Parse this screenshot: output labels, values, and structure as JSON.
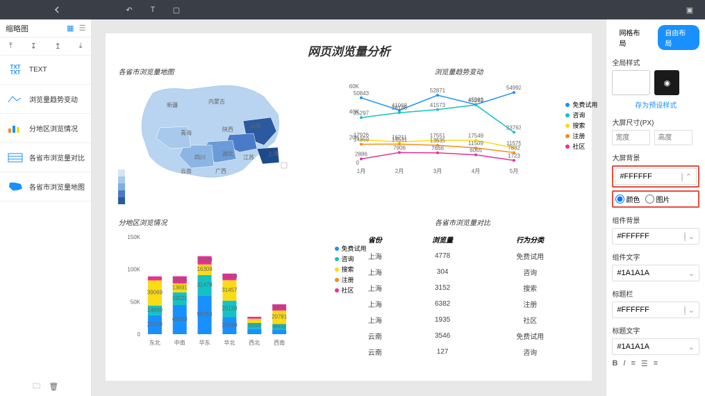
{
  "topbar": {
    "tools": [
      "↶",
      "T",
      "▢"
    ],
    "right": "▣"
  },
  "left": {
    "title": "缩略图",
    "items": [
      {
        "label": "TEXT",
        "thumb": "TXT"
      },
      {
        "label": "浏览量趋势变动",
        "thumb": "line"
      },
      {
        "label": "分地区浏览情况",
        "thumb": "bar"
      },
      {
        "label": "各省市浏览量对比",
        "thumb": "table"
      },
      {
        "label": "各省市浏览量地图",
        "thumb": "map"
      }
    ]
  },
  "dashboard": {
    "title": "网页浏览量分析",
    "map_title": "各省市浏览量地图",
    "line_title": "浏览量趋势变动",
    "bar_title": "分地区浏览情况",
    "table_title": "各省市浏览量对比",
    "table_headers": [
      "省份",
      "浏览量",
      "行为分类"
    ],
    "table_rows": [
      [
        "上海",
        "4778",
        "免费试用"
      ],
      [
        "上海",
        "304",
        "咨询"
      ],
      [
        "上海",
        "3152",
        "搜索"
      ],
      [
        "上海",
        "6382",
        "注册"
      ],
      [
        "上海",
        "1935",
        "社区"
      ],
      [
        "云南",
        "3546",
        "免费试用"
      ],
      [
        "云南",
        "127",
        "咨询"
      ]
    ]
  },
  "chart_data": [
    {
      "type": "line",
      "title": "浏览量趋势变动",
      "x": [
        "1月",
        "2月",
        "3月",
        "4月",
        "5月"
      ],
      "ylim": [
        0,
        60000
      ],
      "series": [
        {
          "name": "免费试用",
          "color": "#1890ff",
          "values": [
            50843,
            41068,
            52871,
            45583,
            54992
          ]
        },
        {
          "name": "咨询",
          "color": "#13c2c2",
          "values": [
            35297,
            39146,
            41573,
            45291,
            23763
          ]
        },
        {
          "name": "搜索",
          "color": "#fadb14",
          "values": [
            17926,
            16211,
            17551,
            17549,
            11575
          ]
        },
        {
          "name": "注册",
          "color": "#fa8c16",
          "values": [
            14359,
            14531,
            13535,
            11509,
            7832
          ]
        },
        {
          "name": "社区",
          "color": "#eb2f96",
          "values": [
            2886,
            7906,
            7666,
            6065,
            1723
          ]
        }
      ]
    },
    {
      "type": "bar",
      "title": "分地区浏览情况",
      "stacked": true,
      "categories": [
        "东北",
        "中南",
        "华东",
        "华北",
        "西北",
        "西南"
      ],
      "ylim": [
        0,
        150000
      ],
      "series": [
        {
          "name": "免费试用",
          "color": "#1890ff",
          "values": [
            29259,
            45033,
            59753,
            26590,
            8220,
            7050
          ]
        },
        {
          "name": "咨询",
          "color": "#13c2c2",
          "values": [
            14690,
            19521,
            31478,
            25130,
            9200,
            8600
          ]
        },
        {
          "name": "搜索",
          "color": "#fadb14",
          "values": [
            39069,
            13691,
            16309,
            31457,
            6400,
            20781
          ]
        },
        {
          "name": "注册",
          "color": "#fa8c16",
          "values": [
            0,
            0,
            0,
            0,
            0,
            0
          ]
        },
        {
          "name": "社区",
          "color": "#eb2f96",
          "values": [
            6082,
            11055,
            12800,
            10300,
            3000,
            9600
          ]
        }
      ]
    }
  ],
  "legend": [
    "免费试用",
    "咨询",
    "搜索",
    "注册",
    "社区"
  ],
  "legend_colors": [
    "#1890ff",
    "#13c2c2",
    "#fadb14",
    "#fa8c16",
    "#eb2f96"
  ],
  "right": {
    "tabs": [
      "网格布局",
      "自由布局"
    ],
    "global_style": "全局样式",
    "preset": "存为预设样式",
    "screen_size": "大屏尺寸(PX)",
    "size_w": "宽度",
    "size_h": "高度",
    "bg": "大屏背景",
    "bg_val": "#FFFFFF",
    "bg_radio1": "颜色",
    "bg_radio2": "图片",
    "comp_bg": "组件背景",
    "comp_bg_val": "#FFFFFF",
    "comp_text": "组件文字",
    "comp_text_val": "#1A1A1A",
    "title_bar": "标题栏",
    "title_bar_val": "#FFFFFF",
    "title_text": "标题文字",
    "title_text_val": "#1A1A1A"
  }
}
